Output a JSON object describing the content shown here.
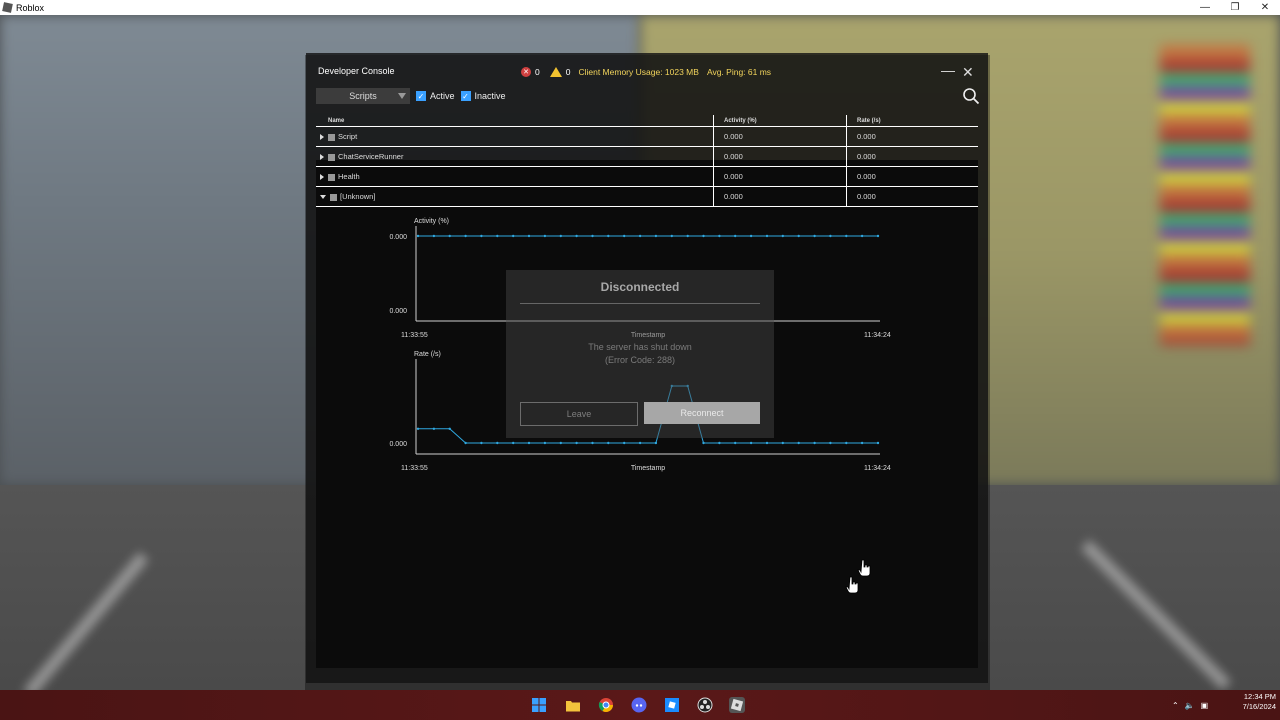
{
  "window": {
    "title": "Roblox"
  },
  "console": {
    "title": "Developer Console",
    "errors": "0",
    "warnings": "0",
    "memory": "Client Memory Usage: 1023 MB",
    "ping": "Avg. Ping: 61 ms",
    "view_selected": "Scripts",
    "filters": {
      "active": "Active",
      "inactive": "Inactive"
    }
  },
  "table": {
    "headers": [
      "Name",
      "Activity (%)",
      "Rate (/s)"
    ],
    "rows": [
      {
        "name": "Script",
        "activity": "0.000",
        "rate": "0.000"
      },
      {
        "name": "ChatServiceRunner",
        "activity": "0.000",
        "rate": "0.000"
      },
      {
        "name": "Health",
        "activity": "0.000",
        "rate": "0.000"
      },
      {
        "name": "[Unknown]",
        "activity": "0.000",
        "rate": "0.000"
      }
    ]
  },
  "chart_data": [
    {
      "type": "line",
      "title": "Activity (%)",
      "xlabel": "Timestamp",
      "x_ticks": [
        "11:33:55",
        "11:34:24"
      ],
      "y_ticks": [
        "0.000",
        "0.000"
      ],
      "series": [
        {
          "values": [
            0,
            0,
            0,
            0,
            0,
            0,
            0,
            0,
            0,
            0,
            0,
            0,
            0,
            0,
            0,
            0,
            0,
            0,
            0,
            0,
            0,
            0,
            0,
            0,
            0,
            0,
            0,
            0,
            0,
            0
          ]
        }
      ]
    },
    {
      "type": "line",
      "title": "Rate (/s)",
      "xlabel": "Timestamp",
      "x_ticks": [
        "11:33:55",
        "11:34:24"
      ],
      "y_ticks": [
        "0.000"
      ],
      "series": [
        {
          "values": [
            1,
            1,
            1,
            0,
            0,
            0,
            0,
            0,
            0,
            0,
            0,
            0,
            0,
            0,
            0,
            0,
            4,
            4,
            0,
            0,
            0,
            0,
            0,
            0,
            0,
            0,
            0,
            0,
            0,
            0
          ]
        }
      ]
    }
  ],
  "dialog": {
    "title": "Disconnected",
    "message_line1": "The server has shut down",
    "message_line2": "(Error Code: 288)",
    "leave": "Leave",
    "reconnect": "Reconnect"
  },
  "taskbar": {
    "time": "12:34 PM",
    "date": "7/16/2024"
  },
  "colors": {
    "accent": "#3aa0ff",
    "series": "#2fa8e0",
    "error": "#d04040",
    "warning": "#f2c230"
  }
}
